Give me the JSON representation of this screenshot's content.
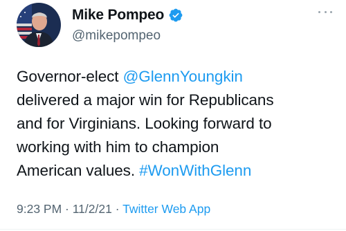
{
  "author": {
    "display_name": "Mike Pompeo",
    "handle": "@mikepompeo",
    "verified_icon": "verified-badge-icon",
    "avatar_icon": "avatar-photo"
  },
  "menu_icon": "more-options-icon",
  "tweet": {
    "line1_text": "Governor-elect ",
    "mention": "@GlennYoungkin",
    "line2": "delivered a major win for Republicans",
    "line3": "and for Virginians. Looking forward to",
    "line4": "working with him to champion",
    "line5_text": "American values. ",
    "hashtag": "#WonWithGlenn"
  },
  "meta": {
    "time": "9:23 PM",
    "separator1": " · ",
    "date": "11/2/21",
    "separator2": " · ",
    "source": "Twitter Web App"
  },
  "colors": {
    "accent": "#1d9bf0",
    "text": "#0f1419",
    "secondary": "#536471"
  }
}
